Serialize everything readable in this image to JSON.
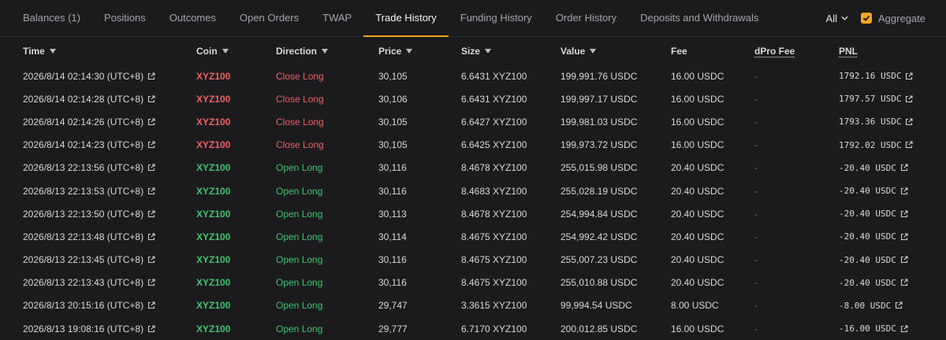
{
  "tabs": [
    {
      "label": "Balances (1)",
      "active": false
    },
    {
      "label": "Positions",
      "active": false
    },
    {
      "label": "Outcomes",
      "active": false
    },
    {
      "label": "Open Orders",
      "active": false
    },
    {
      "label": "TWAP",
      "active": false
    },
    {
      "label": "Trade History",
      "active": true
    },
    {
      "label": "Funding History",
      "active": false
    },
    {
      "label": "Order History",
      "active": false
    },
    {
      "label": "Deposits and Withdrawals",
      "active": false
    }
  ],
  "controls": {
    "filter_label": "All",
    "aggregate_label": "Aggregate",
    "aggregate_checked": true
  },
  "colors": {
    "accent": "#f5a524",
    "buy": "#3fc56b",
    "sell": "#ef6161"
  },
  "columns": {
    "time": "Time",
    "coin": "Coin",
    "direction": "Direction",
    "price": "Price",
    "size": "Size",
    "value": "Value",
    "fee": "Fee",
    "dpro_fee": "dPro Fee",
    "pnl": "PNL"
  },
  "rows": [
    {
      "time": "2026/8/14 02:14:30 (UTC+8)",
      "coin": "XYZ100",
      "direction": "Close Long",
      "side": "sell",
      "price": "30,105",
      "size": "6.6431 XYZ100",
      "value": "199,991.76 USDC",
      "fee": "16.00 USDC",
      "dpro_fee": "-",
      "pnl": "1792.16 USDC"
    },
    {
      "time": "2026/8/14 02:14:28 (UTC+8)",
      "coin": "XYZ100",
      "direction": "Close Long",
      "side": "sell",
      "price": "30,106",
      "size": "6.6431 XYZ100",
      "value": "199,997.17 USDC",
      "fee": "16.00 USDC",
      "dpro_fee": "-",
      "pnl": "1797.57 USDC"
    },
    {
      "time": "2026/8/14 02:14:26 (UTC+8)",
      "coin": "XYZ100",
      "direction": "Close Long",
      "side": "sell",
      "price": "30,105",
      "size": "6.6427 XYZ100",
      "value": "199,981.03 USDC",
      "fee": "16.00 USDC",
      "dpro_fee": "-",
      "pnl": "1793.36 USDC"
    },
    {
      "time": "2026/8/14 02:14:23 (UTC+8)",
      "coin": "XYZ100",
      "direction": "Close Long",
      "side": "sell",
      "price": "30,105",
      "size": "6.6425 XYZ100",
      "value": "199,973.72 USDC",
      "fee": "16.00 USDC",
      "dpro_fee": "-",
      "pnl": "1792.02 USDC"
    },
    {
      "time": "2026/8/13 22:13:56 (UTC+8)",
      "coin": "XYZ100",
      "direction": "Open Long",
      "side": "buy",
      "price": "30,116",
      "size": "8.4678 XYZ100",
      "value": "255,015.98 USDC",
      "fee": "20.40 USDC",
      "dpro_fee": "-",
      "pnl": "-20.40 USDC"
    },
    {
      "time": "2026/8/13 22:13:53 (UTC+8)",
      "coin": "XYZ100",
      "direction": "Open Long",
      "side": "buy",
      "price": "30,116",
      "size": "8.4683 XYZ100",
      "value": "255,028.19 USDC",
      "fee": "20.40 USDC",
      "dpro_fee": "-",
      "pnl": "-20.40 USDC"
    },
    {
      "time": "2026/8/13 22:13:50 (UTC+8)",
      "coin": "XYZ100",
      "direction": "Open Long",
      "side": "buy",
      "price": "30,113",
      "size": "8.4678 XYZ100",
      "value": "254,994.84 USDC",
      "fee": "20.40 USDC",
      "dpro_fee": "-",
      "pnl": "-20.40 USDC"
    },
    {
      "time": "2026/8/13 22:13:48 (UTC+8)",
      "coin": "XYZ100",
      "direction": "Open Long",
      "side": "buy",
      "price": "30,114",
      "size": "8.4675 XYZ100",
      "value": "254,992.42 USDC",
      "fee": "20.40 USDC",
      "dpro_fee": "-",
      "pnl": "-20.40 USDC"
    },
    {
      "time": "2026/8/13 22:13:45 (UTC+8)",
      "coin": "XYZ100",
      "direction": "Open Long",
      "side": "buy",
      "price": "30,116",
      "size": "8.4675 XYZ100",
      "value": "255,007.23 USDC",
      "fee": "20.40 USDC",
      "dpro_fee": "-",
      "pnl": "-20.40 USDC"
    },
    {
      "time": "2026/8/13 22:13:43 (UTC+8)",
      "coin": "XYZ100",
      "direction": "Open Long",
      "side": "buy",
      "price": "30,116",
      "size": "8.4675 XYZ100",
      "value": "255,010.88 USDC",
      "fee": "20.40 USDC",
      "dpro_fee": "-",
      "pnl": "-20.40 USDC"
    },
    {
      "time": "2026/8/13 20:15:16 (UTC+8)",
      "coin": "XYZ100",
      "direction": "Open Long",
      "side": "buy",
      "price": "29,747",
      "size": "3.3615 XYZ100",
      "value": "99,994.54 USDC",
      "fee": "8.00 USDC",
      "dpro_fee": "-",
      "pnl": "-8.00 USDC"
    },
    {
      "time": "2026/8/13 19:08:16 (UTC+8)",
      "coin": "XYZ100",
      "direction": "Open Long",
      "side": "buy",
      "price": "29,777",
      "size": "6.7170 XYZ100",
      "value": "200,012.85 USDC",
      "fee": "16.00 USDC",
      "dpro_fee": "-",
      "pnl": "-16.00 USDC"
    }
  ]
}
